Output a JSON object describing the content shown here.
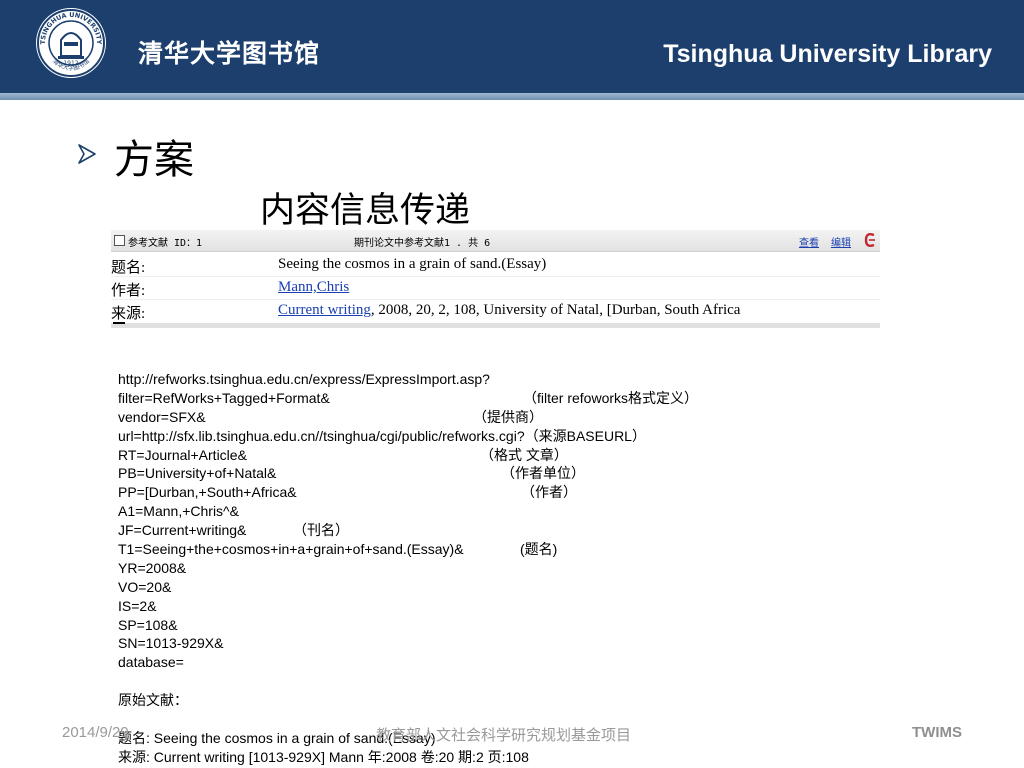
{
  "header": {
    "title_cn": "清华大学图书馆",
    "title_en": "Tsinghua University Library",
    "logo_ring_text": "TSINGHUA UNIVERSITY",
    "logo_ring_text_cn": "清华大学图书馆",
    "logo_year": "1912"
  },
  "colors": {
    "header_bg": "#1c3f6e",
    "header_stripe": "#8aa6c4",
    "link": "#1a3fb0",
    "footer_text": "#9a9a9a"
  },
  "slide": {
    "heading": "方案",
    "subheading": "内容信息传递",
    "bullet_icon": "arrow-bullet-icon"
  },
  "record": {
    "bar_left": "参考文献 ID：1",
    "bar_center": "期刊论文中参考文献1 . 共 6",
    "link_view": "查看",
    "link_edit": "编辑",
    "refworks_icon": "refworks-icon",
    "rows": [
      {
        "label": "题名:",
        "value": "Seeing the cosmos in a grain of sand.(Essay)"
      },
      {
        "label": "作者:",
        "link": "Mann,Chris"
      },
      {
        "label": "来源:",
        "link": "Current writing",
        "rest": ", 2008, 20, 2, 108, University of Natal, [Durban, South Africa"
      }
    ]
  },
  "code_lines": [
    {
      "text": "http://refworks.tsinghua.edu.cn/express/ExpressImport.asp?"
    },
    {
      "text": "filter=RefWorks+Tagged+Format&",
      "note": "（filter  refoworks格式定义）"
    },
    {
      "text": "vendor=SFX&",
      "note": "（提供商）"
    },
    {
      "text": "url=http://sfx.lib.tsinghua.edu.cn//tsinghua/cgi/public/refworks.cgi?（来源BASEURL）"
    },
    {
      "text": "RT=Journal+Article&",
      "note": "（格式 文章）"
    },
    {
      "text": "PB=University+of+Natal&",
      "note": "（作者单位）"
    },
    {
      "text": "PP=[Durban,+South+Africa&",
      "note": "（作者）"
    },
    {
      "text": "A1=Mann,+Chris^&"
    },
    {
      "text": "JF=Current+writing&",
      "note": "（刊名）"
    },
    {
      "text": "T1=Seeing+the+cosmos+in+a+grain+of+sand.(Essay)&",
      "note": "(题名)"
    },
    {
      "text": "YR=2008&"
    },
    {
      "text": "VO=20&"
    },
    {
      "text": "IS=2&"
    },
    {
      "text": "SP=108&"
    },
    {
      "text": "SN=1013-929X&"
    },
    {
      "text": "database="
    },
    {
      "text": ""
    },
    {
      "text": "原始文献："
    },
    {
      "text": ""
    },
    {
      "text": "题名: Seeing the cosmos in a grain of sand.(Essay)"
    },
    {
      "text": "来源: Current writing [1013-929X] Mann 年:2008 卷:20 期:2 页:108"
    }
  ],
  "footer": {
    "date": "2014/9/29",
    "project": "教育部人文社会科学研究规划基金项目",
    "brand": "TWIMS"
  }
}
